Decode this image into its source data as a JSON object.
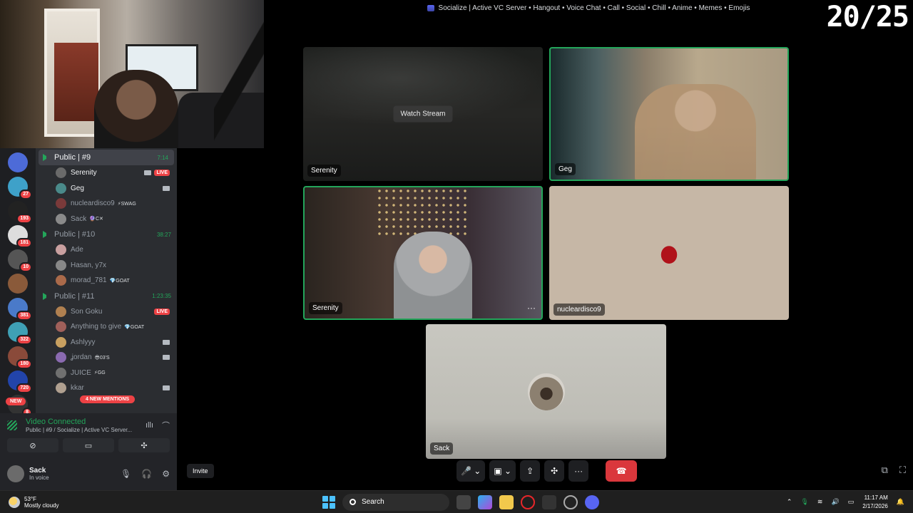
{
  "window": {
    "title": "Socialize | Active VC Server • Hangout • Voice Chat • Call • Social • Chill • Anime • Memes • Emojis",
    "overlay_counter": "20/25"
  },
  "servers": [
    {
      "icon": "top-server-icon",
      "badge": ""
    },
    {
      "icon": "socialize-server-icon",
      "badge": "27"
    },
    {
      "icon": "ybn-server-icon",
      "badge": "193"
    },
    {
      "icon": "server-icon",
      "badge": "181"
    },
    {
      "icon": "server-icon",
      "badge": "10"
    },
    {
      "icon": "server-icon",
      "badge": ""
    },
    {
      "icon": "server-icon",
      "badge": "381"
    },
    {
      "icon": "server-icon",
      "badge": "322"
    },
    {
      "icon": "server-icon",
      "badge": "180"
    },
    {
      "icon": "server-icon",
      "badge": "720"
    },
    {
      "icon": "server-icon",
      "badge": "8"
    }
  ],
  "server_new_pill": "NEW",
  "channels": [
    {
      "name": "Public | #9",
      "time": "7:14",
      "active": true,
      "members": [
        {
          "name": "Serenity",
          "tag": "",
          "live": "LIVE",
          "camera": true,
          "bright": true
        },
        {
          "name": "Geg",
          "tag": "",
          "live": "",
          "camera": true,
          "bright": true
        },
        {
          "name": "nucleardisco9",
          "tag": "⚡SWAG",
          "live": "",
          "camera": false,
          "bright": false
        },
        {
          "name": "Sack",
          "tag": "🔮C✕",
          "live": "",
          "camera": false,
          "bright": false
        }
      ]
    },
    {
      "name": "Public | #10",
      "time": "38:27",
      "active": false,
      "members": [
        {
          "name": "Ade",
          "tag": "",
          "live": "",
          "camera": false,
          "bright": false
        },
        {
          "name": "Hasan, y7x",
          "tag": "",
          "live": "",
          "camera": false,
          "bright": false
        },
        {
          "name": "morad_781",
          "tag": "💎GOAT",
          "live": "",
          "camera": false,
          "bright": false
        }
      ]
    },
    {
      "name": "Public | #11",
      "time": "1:23:35",
      "active": false,
      "members": [
        {
          "name": "Son Goku",
          "tag": "",
          "live": "LIVE",
          "camera": false,
          "bright": false
        },
        {
          "name": "Anything to give",
          "tag": "💎GOAT",
          "live": "",
          "camera": false,
          "bright": false
        },
        {
          "name": "Ashlyyy",
          "tag": "",
          "live": "",
          "camera": true,
          "bright": false
        },
        {
          "name": "ʝordan",
          "tag": "😎03'S",
          "live": "",
          "camera": true,
          "bright": false
        },
        {
          "name": "JUICE",
          "tag": "⚡GG",
          "live": "",
          "camera": false,
          "bright": false
        },
        {
          "name": "kkar",
          "tag": "",
          "live": "",
          "camera": true,
          "bright": false
        }
      ]
    }
  ],
  "mentions_pill": "4 NEW MENTIONS",
  "voice_panel": {
    "status": "Video Connected",
    "channel": "Public | #9 / Socialize | Active VC Server..."
  },
  "user_panel": {
    "name": "Sack",
    "status": "In voice"
  },
  "invite_label": "Invite",
  "tiles": {
    "stream": {
      "label": "Serenity",
      "watch": "Watch Stream"
    },
    "geg": {
      "label": "Geg"
    },
    "serenity": {
      "label": "Serenity",
      "more": "···"
    },
    "nuclear": {
      "label": "nucleardisco9"
    },
    "sack": {
      "label": "Sack"
    }
  },
  "controls": {
    "mic": "🎤",
    "camera_off": "▣",
    "share": "⇪",
    "activity": "✣",
    "more": "···",
    "end": "☎"
  },
  "taskbar": {
    "temp": "53°F",
    "weather": "Mostly cloudy",
    "search": "Search",
    "time": "11:17 AM",
    "date": "2/17/2026"
  }
}
